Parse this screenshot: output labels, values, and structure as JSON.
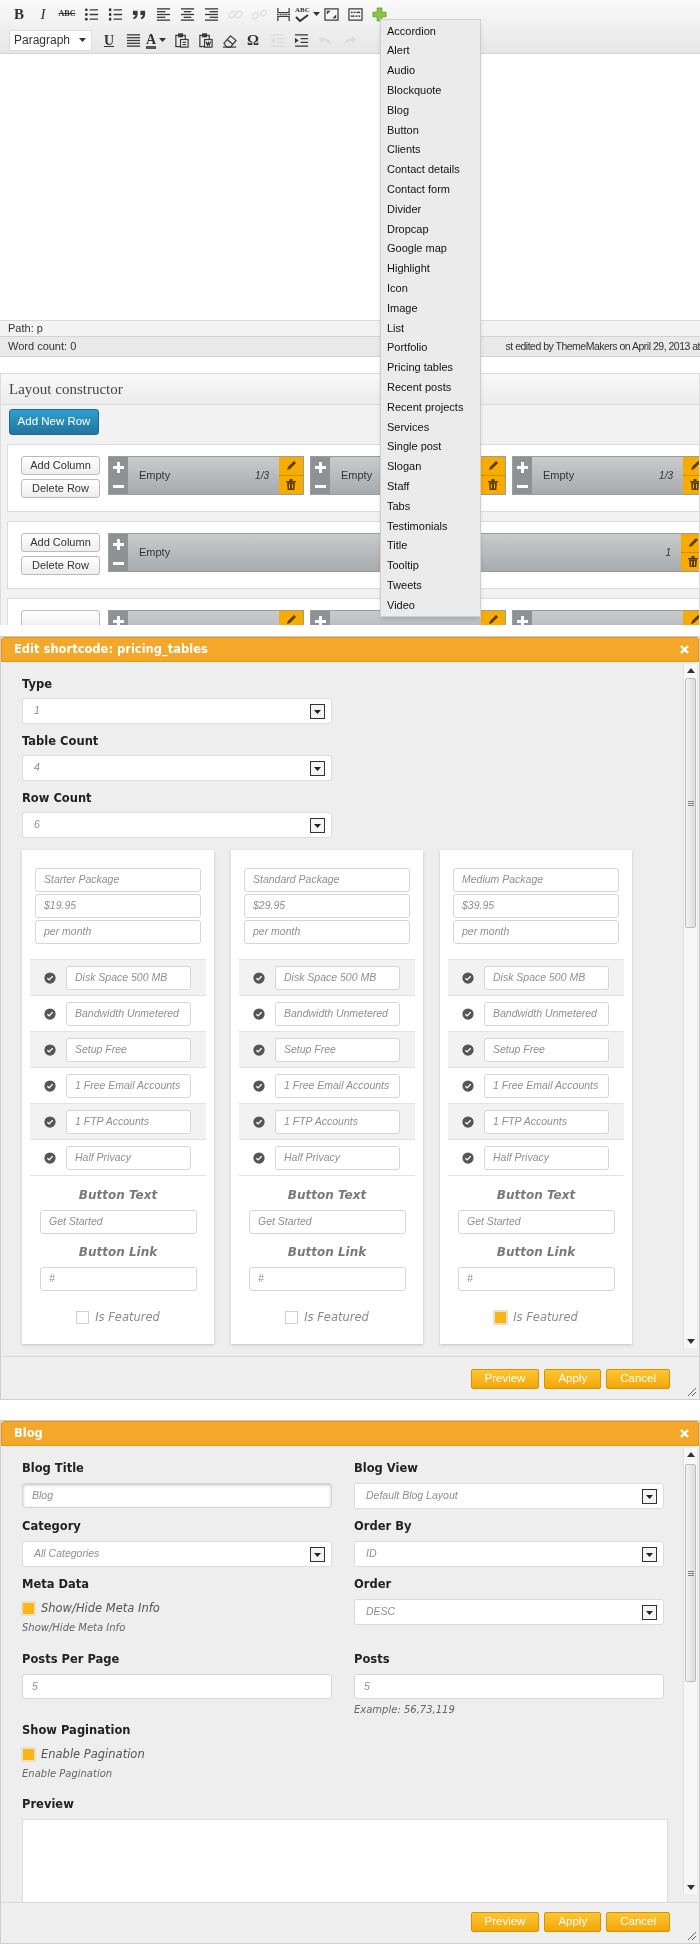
{
  "editor": {
    "toolbar": [
      [
        {
          "kind": "bold",
          "label": "B"
        },
        {
          "kind": "italic",
          "label": "I"
        },
        {
          "kind": "strike",
          "label": "ABC"
        },
        {
          "kind": "icon",
          "disabled": false
        },
        {
          "kind": "icon",
          "disabled": false
        },
        {
          "kind": "icon",
          "disabled": false
        },
        {
          "kind": "icon",
          "disabled": false
        },
        {
          "kind": "icon",
          "disabled": false
        },
        {
          "kind": "icon",
          "disabled": false
        },
        {
          "kind": "icon",
          "disabled": true
        },
        {
          "kind": "icon",
          "disabled": true
        },
        {
          "kind": "icon",
          "disabled": false
        },
        {
          "kind": "spell",
          "label": "ABC"
        },
        {
          "kind": "icon",
          "disabled": false
        },
        {
          "kind": "icon",
          "disabled": false
        },
        {
          "kind": "icon",
          "disabled": false
        }
      ],
      [
        {
          "kind": "select",
          "label": "Paragraph"
        },
        {
          "kind": "underline",
          "label": "U"
        },
        {
          "kind": "icon",
          "disabled": false
        },
        {
          "kind": "color",
          "label": "A"
        },
        {
          "kind": "icon",
          "disabled": false
        },
        {
          "kind": "icon",
          "disabled": false
        },
        {
          "kind": "icon",
          "disabled": false
        },
        {
          "kind": "symbol",
          "label": "Ω"
        },
        {
          "kind": "icon",
          "disabled": true
        },
        {
          "kind": "icon",
          "disabled": false
        },
        {
          "kind": "icon",
          "disabled": true
        },
        {
          "kind": "icon",
          "disabled": true
        }
      ]
    ],
    "path": "Path: p",
    "word_count": "Word count: 0",
    "last_edited": "st edited by ThemeMakers on April 29, 2013 at"
  },
  "shortcode_menu": {
    "items": [
      "Accordion",
      "Alert",
      "Audio",
      "Blockquote",
      "Blog",
      "Button",
      "Clients",
      "Contact details",
      "Contact form",
      "Divider",
      "Dropcap",
      "Google map",
      "Highlight",
      "Icon",
      "Image",
      "List",
      "Portfolio",
      "Pricing tables",
      "Recent posts",
      "Recent projects",
      "Services",
      "Single post",
      "Slogan",
      "Staff",
      "Tabs",
      "Testimonials",
      "Title",
      "Tooltip",
      "Tweets",
      "Video"
    ]
  },
  "layout_constructor": {
    "title": "Layout constructor",
    "add_row": "Add New Row",
    "rows": [
      {
        "kind": "row",
        "buttons": [
          "Add Column",
          "Delete Row"
        ],
        "columns": [
          {
            "label": "Empty",
            "size": "1/3"
          },
          {
            "label": "Empty"
          },
          {
            "label": "Empty",
            "size": "1/3"
          }
        ]
      },
      {
        "kind": "row",
        "buttons": [
          "Add Column",
          "Delete Row"
        ],
        "columns": [
          {
            "label": "Empty",
            "size": "1"
          }
        ]
      },
      {
        "kind": "cut",
        "columns": [
          {
            "kind": "blank"
          },
          {
            "kind": "blank"
          },
          {
            "kind": "blank"
          }
        ]
      }
    ]
  },
  "pricing_dialog": {
    "title": "Edit shortcode: pricing_tables",
    "fields": [
      {
        "label": "Type",
        "value": "1"
      },
      {
        "label": "Table Count",
        "value": "4"
      },
      {
        "label": "Row Count",
        "value": "6"
      }
    ],
    "tables": [
      {
        "name": "Starter Package",
        "price": "$19.95",
        "period": "per month",
        "features": [
          "Disk Space 500 MB",
          "Bandwidth Unmetered",
          "Setup Free",
          "1 Free Email Accounts",
          "1 FTP Accounts",
          "Half Privacy"
        ],
        "button_text_label": "Button Text",
        "button_text": "Get Started",
        "button_link_label": "Button Link",
        "button_link": "#",
        "featured_label": "Is Featured",
        "featured": false
      },
      {
        "name": "Standard Package",
        "price": "$29.95",
        "period": "per month",
        "features": [
          "Disk Space 500 MB",
          "Bandwidth Unmetered",
          "Setup Free",
          "1 Free Email Accounts",
          "1 FTP Accounts",
          "Half Privacy"
        ],
        "button_text_label": "Button Text",
        "button_text": "Get Started",
        "button_link_label": "Button Link",
        "button_link": "#",
        "featured_label": "Is Featured",
        "featured": false
      },
      {
        "name": "Medium Package",
        "price": "$39.95",
        "period": "per month",
        "features": [
          "Disk Space 500 MB",
          "Bandwidth Unmetered",
          "Setup Free",
          "1 Free Email Accounts",
          "1 FTP Accounts",
          "Half Privacy"
        ],
        "button_text_label": "Button Text",
        "button_text": "Get Started",
        "button_link_label": "Button Link",
        "button_link": "#",
        "featured_label": "Is Featured",
        "featured": true
      }
    ],
    "buttons": [
      "Preview",
      "Apply",
      "Cancel"
    ]
  },
  "blog_dialog": {
    "title": "Blog",
    "rows": [
      [
        {
          "kind": "text",
          "label": "Blog Title",
          "value": "Blog",
          "focused": true
        },
        {
          "kind": "select",
          "label": "Blog View",
          "value": "Default Blog Layout"
        }
      ],
      [
        {
          "kind": "select",
          "label": "Category",
          "value": "All Categories"
        },
        {
          "kind": "select",
          "label": "Order By",
          "value": "ID"
        }
      ],
      [
        {
          "kind": "checkbox",
          "label": "Meta Data",
          "option": "Show/Hide Meta Info",
          "checked": true,
          "help": "Show/Hide Meta Info"
        },
        {
          "kind": "select",
          "label": "Order",
          "value": "DESC"
        }
      ],
      [
        {
          "kind": "text",
          "label": "Posts Per Page",
          "value": "5",
          "focused": false
        },
        {
          "kind": "text",
          "label": "Posts",
          "value": "5",
          "focused": false,
          "help": "Example: 56,73,119"
        }
      ],
      [
        {
          "kind": "checkbox",
          "label": "Show Pagination",
          "option": "Enable Pagination",
          "checked": true,
          "help": "Enable Pagination"
        }
      ],
      [
        {
          "kind": "textarea",
          "label": "Preview"
        }
      ]
    ],
    "buttons": [
      "Preview",
      "Apply",
      "Cancel"
    ]
  }
}
